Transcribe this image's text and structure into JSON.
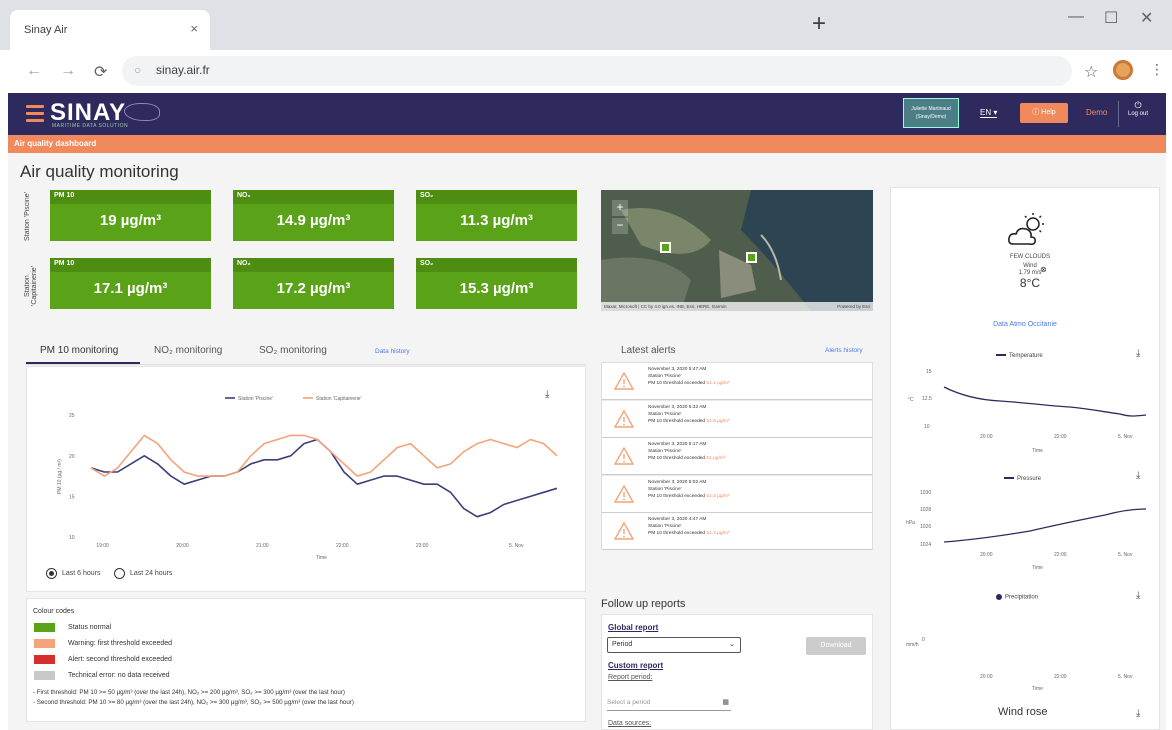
{
  "browser": {
    "tab_title": "Sinay Air",
    "tab_close": "×",
    "new_tab": "+",
    "minimize": "—",
    "maximize": "☐",
    "close": "✕",
    "back": "←",
    "forward": "→",
    "reload": "⟳",
    "url": "sinay.air.fr",
    "bookmark": "☆",
    "menu": "⋮"
  },
  "header": {
    "logo": "SINAY",
    "logo_subtitle": "MARITIME DATA SOLUTION",
    "user_badge": "Juliette Martinaud (Sinay/Demo)",
    "language": "EN ▾",
    "help": "ⓘ Help",
    "demo": "Demo",
    "logout": "Log out"
  },
  "breadcrumb": "Air quality dashboard",
  "page_title": "Air quality monitoring",
  "stations": [
    {
      "label": "Station 'Piscine'",
      "tiles": [
        {
          "pollutant": "PM 10",
          "value": "19 µg/m³"
        },
        {
          "pollutant": "NO₂",
          "value": "14.9 µg/m³"
        },
        {
          "pollutant": "SO₂",
          "value": "11.3 µg/m³"
        }
      ]
    },
    {
      "label": "Station 'Capitainerie'",
      "tiles": [
        {
          "pollutant": "PM 10",
          "value": "17.1 µg/m³"
        },
        {
          "pollutant": "NO₂",
          "value": "17.2 µg/m³"
        },
        {
          "pollutant": "SO₂",
          "value": "15.3 µg/m³"
        }
      ]
    }
  ],
  "map": {
    "zoom_in": "+",
    "zoom_out": "−",
    "attribution": "Maxar, Microsoft | CC by 4.0 ign.es, INE, Esri, HERE, Garmin",
    "powered": "Powered by Esri"
  },
  "monitoring": {
    "tabs": [
      "PM 10 monitoring",
      "NO₂ monitoring",
      "SO₂ monitoring"
    ],
    "history_link": "Data history",
    "download": "⤓",
    "radio_6h": "Last 6 hours",
    "radio_24h": "Last 24 hours"
  },
  "chart_data": {
    "type": "line",
    "xlabel": "Time",
    "ylabel": "PM 10 (µg / m³)",
    "ylim": [
      10,
      26
    ],
    "yticks": [
      10,
      15,
      20,
      25
    ],
    "x": [
      "18:50",
      "19:00",
      "19:10",
      "19:20",
      "19:30",
      "19:40",
      "19:50",
      "20:00",
      "20:10",
      "20:20",
      "20:30",
      "20:40",
      "20:50",
      "21:00",
      "21:10",
      "21:20",
      "21:30",
      "21:40",
      "21:50",
      "22:00",
      "22:10",
      "22:20",
      "22:30",
      "22:40",
      "22:50",
      "23:00",
      "23:10",
      "23:20",
      "23:30",
      "23:40",
      "23:50",
      "0:00",
      "0:10",
      "0:20",
      "0:30",
      "0:40"
    ],
    "xticks": [
      "19:00",
      "20:00",
      "21:00",
      "22:00",
      "23:00",
      "5. Nov"
    ],
    "grid": false,
    "legend": "top",
    "series": [
      {
        "name": "Station 'Piscine'",
        "color": "#3b3f7a",
        "values": [
          18.5,
          18.0,
          18.0,
          19.0,
          20.0,
          19.0,
          17.5,
          16.5,
          17.0,
          17.5,
          17.5,
          18.0,
          19.0,
          19.5,
          19.5,
          20.0,
          21.5,
          22.0,
          20.5,
          18.0,
          16.5,
          17.0,
          17.5,
          17.5,
          17.0,
          16.5,
          16.5,
          15.5,
          13.5,
          12.5,
          13.0,
          14.0,
          14.5,
          15.0,
          15.5,
          16.0
        ]
      },
      {
        "name": "Station 'Capitainerie'",
        "color": "#f4a37a",
        "values": [
          18.5,
          17.5,
          18.5,
          20.5,
          22.5,
          21.5,
          19.5,
          18.0,
          17.5,
          17.5,
          17.5,
          18.0,
          20.0,
          21.5,
          22.0,
          22.5,
          22.5,
          22.0,
          20.5,
          19.0,
          17.5,
          18.0,
          19.5,
          21.0,
          21.5,
          20.0,
          18.5,
          19.0,
          20.5,
          21.5,
          22.0,
          21.5,
          21.0,
          22.0,
          21.5,
          20.0
        ]
      }
    ]
  },
  "colour_codes": {
    "title": "Colour codes",
    "items": [
      {
        "label": "Status normal",
        "color": "#5aa318"
      },
      {
        "label": "Warning: first threshold exceeded",
        "color": "#f4a37a"
      },
      {
        "label": "Alert: second threshold exceeded",
        "color": "#d62e2e"
      },
      {
        "label": "Technical error: no data received",
        "color": "#c8c8c8"
      }
    ],
    "threshold_1": "- First threshold: PM 10 >= 50 µg/m³ (over the last 24h), NO₂ >= 200 µg/m³, SO₂ >= 300 µg/m³ (over the last hour)",
    "threshold_2": "- Second threshold: PM 10 >= 80 µg/m³ (over the last 24h), NO₂ >= 300 µg/m³, SO₂ >= 500 µg/m³ (over the last hour)"
  },
  "alerts": {
    "title": "Latest alerts",
    "history_link": "Alerts history",
    "items": [
      {
        "date": "November 3, 2020 5:47 AM",
        "station": "Station 'Piscine'",
        "text": "PM 10 threshold exceeded",
        "value": "51.1 µg/m³"
      },
      {
        "date": "November 3, 2020 5:32 AM",
        "station": "Station 'Piscine'",
        "text": "PM 10 threshold exceeded",
        "value": "51.9 µg/m³"
      },
      {
        "date": "November 3, 2020 5:17 AM",
        "station": "Station 'Piscine'",
        "text": "PM 10 threshold exceeded",
        "value": "51 µg/m³"
      },
      {
        "date": "November 3, 2020 5:02 AM",
        "station": "Station 'Piscine'",
        "text": "PM 10 threshold exceeded",
        "value": "51.3 µg/m³"
      },
      {
        "date": "November 3, 2020 4:47 AM",
        "station": "Station 'Piscine'",
        "text": "PM 10 threshold exceeded",
        "value": "51.3 µg/m³"
      }
    ]
  },
  "reports": {
    "title": "Follow up reports",
    "global": "Global report",
    "period_select": "Period",
    "download": "Download",
    "custom": "Custom report",
    "report_period": "Report period:",
    "period_placeholder": "Select a period",
    "data_sources": "Data sources:"
  },
  "weather": {
    "condition": "FEW CLOUDS",
    "wind_label": "Wind",
    "wind_speed": "1.79 m/s",
    "temperature": "8°C",
    "source_link": "Data Atmo Occitanie"
  },
  "mini_charts": [
    {
      "legend": "Temperature",
      "ylabel": "°C",
      "yticks": [
        "15",
        "12.5",
        "10"
      ],
      "xticks": [
        "20:00",
        "22:00",
        "5. Nov"
      ],
      "xlabel": "Time"
    },
    {
      "legend": "Pressure",
      "ylabel": "hPa",
      "yticks": [
        "1030",
        "1028",
        "1026",
        "1024"
      ],
      "xticks": [
        "20:00",
        "22:00",
        "5. Nov"
      ],
      "xlabel": "Time"
    },
    {
      "legend": "Precipitation",
      "ylabel": "mm/h",
      "yticks": [
        "0"
      ],
      "xticks": [
        "20:00",
        "22:00",
        "5. Nov"
      ],
      "xlabel": "Time"
    }
  ],
  "wind_rose_title": "Wind rose"
}
